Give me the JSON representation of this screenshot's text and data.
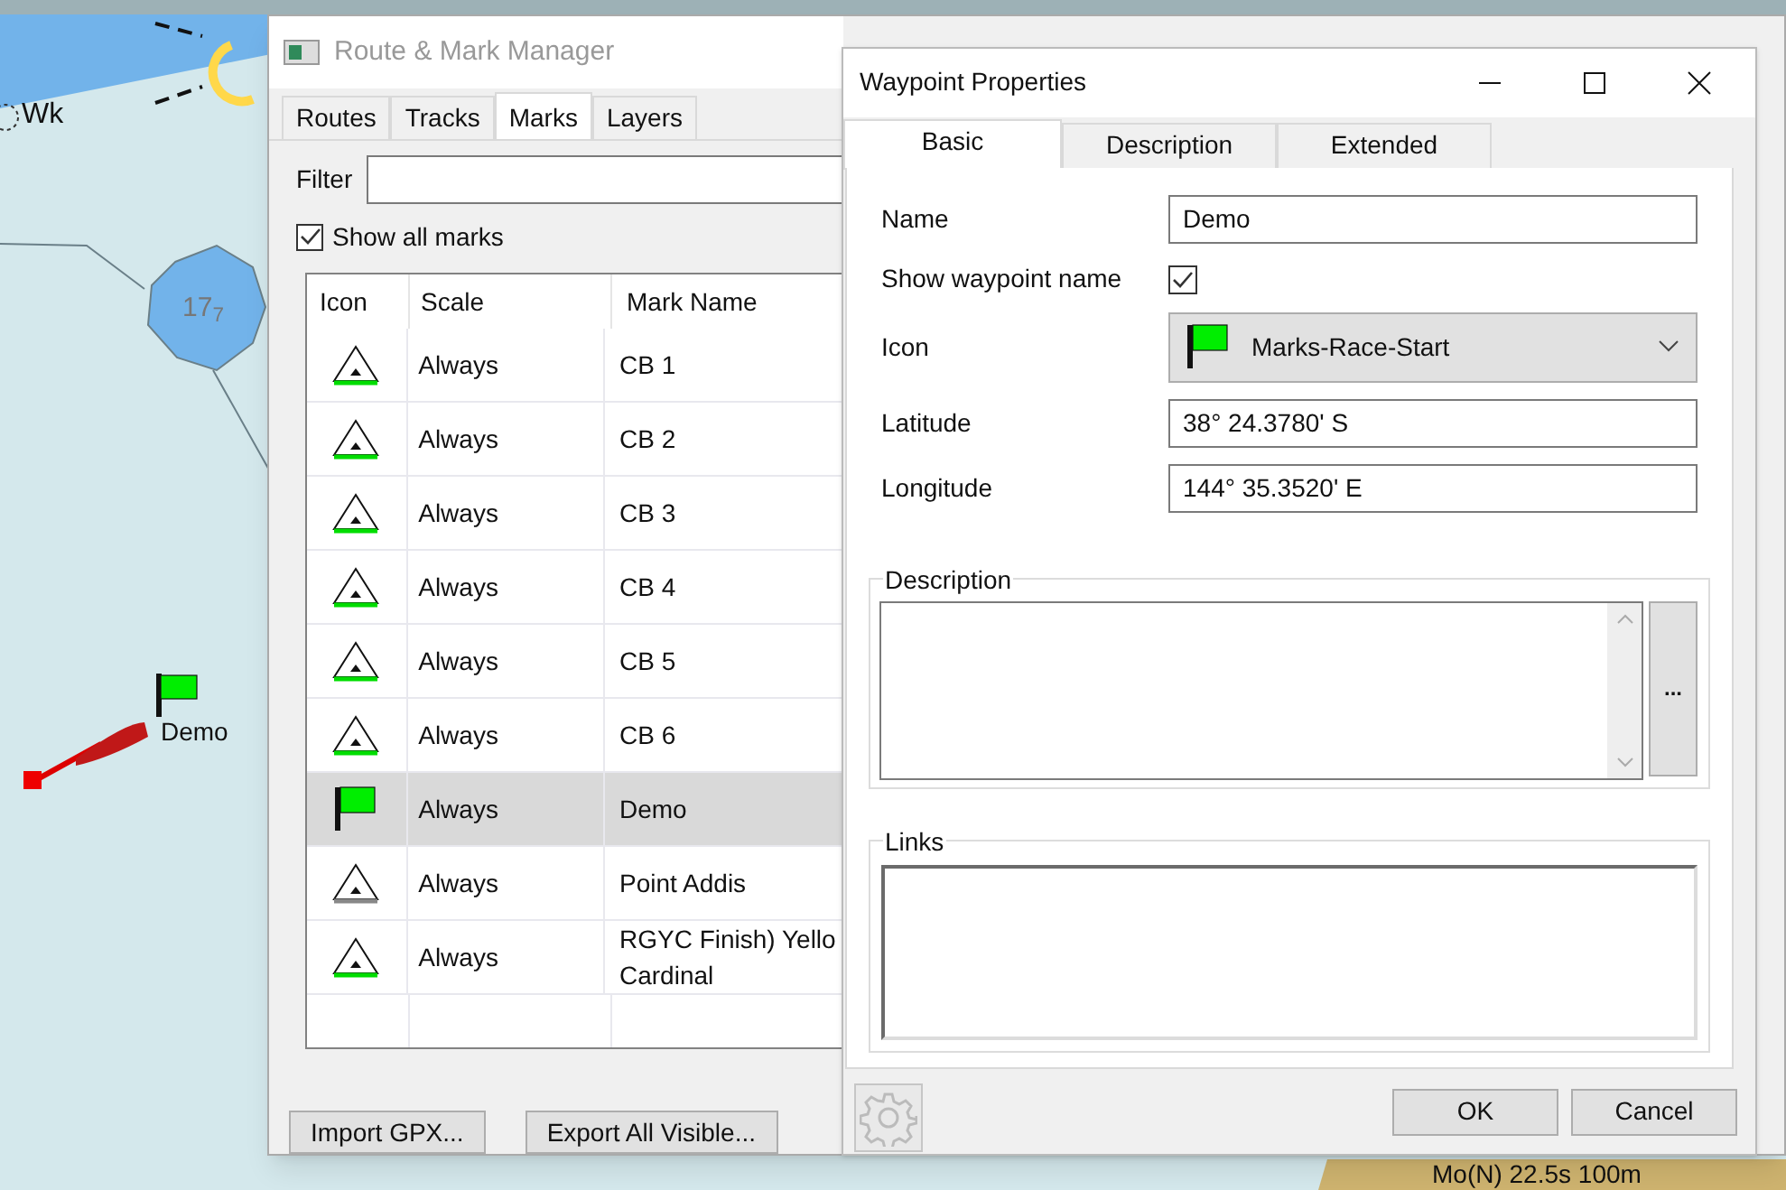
{
  "chart": {
    "labels": [
      {
        "kind": "place",
        "text": "Wk"
      },
      {
        "kind": "depth",
        "text": "17$_{7}$"
      },
      {
        "kind": "waypoint",
        "text": "Demo"
      },
      {
        "kind": "light",
        "text": "Mo(N) 22.5s 100m"
      }
    ]
  },
  "manager": {
    "title": "Route & Mark Manager",
    "tabs": [
      {
        "label": "Routes",
        "selected": false
      },
      {
        "label": "Tracks",
        "selected": false
      },
      {
        "label": "Marks",
        "selected": true
      },
      {
        "label": "Layers",
        "selected": false
      }
    ],
    "filter": {
      "label": "Filter"
    },
    "show_all": {
      "label": "Show all marks",
      "checked": true
    },
    "table": {
      "columns": [
        "Icon",
        "Scale",
        "Mark Name"
      ],
      "rows": [
        {
          "kind": "triangle",
          "color": "#00dd00",
          "scale": "Always",
          "name": "CB 1",
          "selected": false
        },
        {
          "kind": "triangle",
          "color": "#00dd00",
          "scale": "Always",
          "name": "CB 2",
          "selected": false
        },
        {
          "kind": "triangle",
          "color": "#00dd00",
          "scale": "Always",
          "name": "CB 3",
          "selected": false
        },
        {
          "kind": "triangle",
          "color": "#00dd00",
          "scale": "Always",
          "name": "CB 4",
          "selected": false
        },
        {
          "kind": "triangle",
          "color": "#00dd00",
          "scale": "Always",
          "name": "CB 5",
          "selected": false
        },
        {
          "kind": "triangle",
          "color": "#00dd00",
          "scale": "Always",
          "name": "CB 6",
          "selected": false
        },
        {
          "kind": "flag",
          "scale": "Always",
          "name": "Demo",
          "selected": true
        },
        {
          "kind": "triangle",
          "color": "#888888",
          "scale": "Always",
          "name": "Point Addis",
          "selected": false
        },
        {
          "kind": "triangle",
          "color": "#00dd00",
          "scale": "Always",
          "name": "RGYC Finish) Yello Cardinal",
          "selected": false
        }
      ]
    },
    "buttons": [
      "Import GPX...",
      "Export All Visible..."
    ]
  },
  "dialog": {
    "title": "Waypoint Properties",
    "tabs": [
      {
        "label": "Basic",
        "selected": true
      },
      {
        "label": "Description",
        "selected": false
      },
      {
        "label": "Extended",
        "selected": false
      }
    ],
    "name": {
      "label": "Name",
      "value": "Demo"
    },
    "show_name": {
      "label": "Show waypoint name",
      "checked": true
    },
    "icon": {
      "label": "Icon",
      "value": "Marks-Race-Start"
    },
    "latitude": {
      "label": "Latitude",
      "value": "38° 24.3780' S"
    },
    "longitude": {
      "label": "Longitude",
      "value": "144° 35.3520' E"
    },
    "description": {
      "legend": "Description",
      "more": "..."
    },
    "links": {
      "legend": "Links"
    },
    "buttons": [
      "OK",
      "Cancel"
    ]
  }
}
